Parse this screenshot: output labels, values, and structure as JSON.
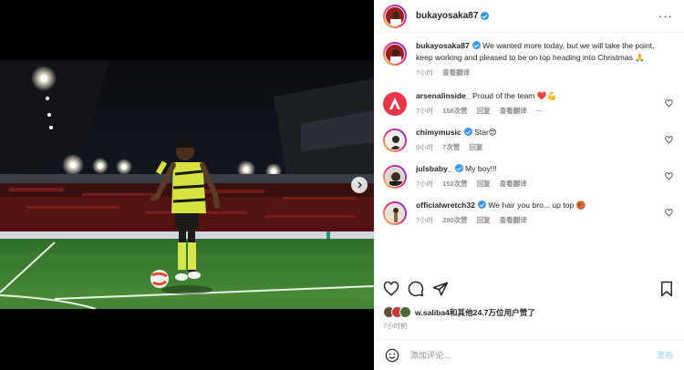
{
  "post": {
    "author": "bukayosaka87",
    "menu_icon": "more-horizontal-icon",
    "caption": {
      "username": "bukayosaka87",
      "text": "We wanted more today, but we will take the point, keep working and pleased to be on top heading into Christmas 🙏",
      "time": "7小时",
      "translate": "查看翻译"
    },
    "comments": [
      {
        "username": "arsenalinside_",
        "text": "Proud of the team ❤️💪",
        "verified": false,
        "time": "7小时",
        "likes": "158次赞",
        "reply": "回复",
        "translate": "查看翻译",
        "more": "···"
      },
      {
        "username": "chimymusic",
        "text": "Star😍",
        "verified": true,
        "time": "6小时",
        "likes": "7次赞",
        "reply": "回复"
      },
      {
        "username": "julsbaby_",
        "text": "My boy!!!",
        "verified": true,
        "time": "7小时",
        "likes": "152次赞",
        "reply": "回复",
        "translate": "查看翻译"
      },
      {
        "username": "officialwretch32",
        "text": "We hair you bro... up top 🏀",
        "verified": true,
        "time": "7小时",
        "likes": "290次赞",
        "reply": "回复",
        "translate": "查看翻译"
      }
    ],
    "likes_text": "w.saliba4和其他24.7万位用户赞了",
    "post_time": "7小时前",
    "composer": {
      "placeholder": "添加评论...",
      "post_label": "发布"
    }
  },
  "colors": {
    "verified": "#3897f0",
    "post_disabled": "#b2dffc",
    "muted": "#8e8e8e"
  }
}
